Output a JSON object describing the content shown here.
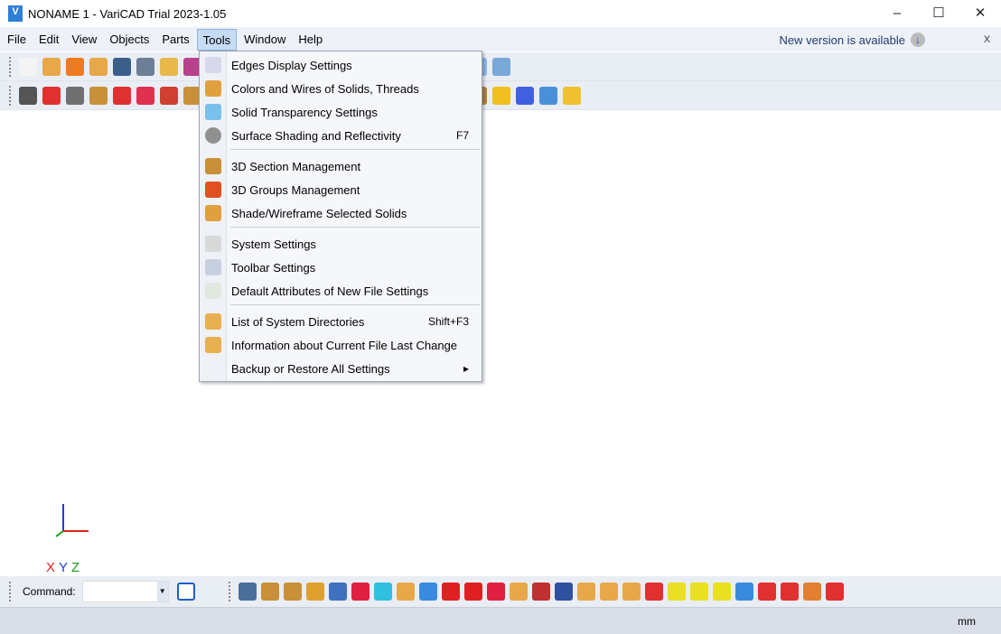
{
  "window": {
    "title": "NONAME 1 - VariCAD Trial 2023-1.05",
    "logo": "VariCAD",
    "minimize": "–",
    "maximize": "☐",
    "close": "✕"
  },
  "menubar": {
    "items": [
      "File",
      "Edit",
      "View",
      "Objects",
      "Parts",
      "Tools",
      "Window",
      "Help"
    ],
    "active": "Tools",
    "new_version": "New version is available",
    "download_icon": "↓",
    "close_label": "x"
  },
  "toolbar": {
    "row1": [
      "#f4f4f4",
      "#e8a84a",
      "#f07a20",
      "#e8a84a",
      "#3c5f8a",
      "#6c7f96",
      "#e8b84a",
      "#b8408c",
      "#7ab0e0",
      "#5a9ad6",
      "#6aa8e0",
      "#4a86c8",
      "#909090",
      "#808080",
      "#a0a0a0",
      "#c89038",
      "#d04040",
      "#7ab8e0",
      "#8ab8e8",
      "#7aa8d8"
    ],
    "row2": [
      "#555555",
      "#e03030",
      "#707070",
      "#c89038",
      "#e03030",
      "#e03050",
      "#d04030",
      "#c89038",
      "#c03030",
      "#a0a8b0",
      "#e04020",
      "#f07020",
      "#f07020",
      "#e04020",
      "#f07020",
      "#f07020",
      "#f07020",
      "#f0c020",
      "#b08040",
      "#f0c020",
      "#4060e0",
      "#4a90d8",
      "#f0c030"
    ]
  },
  "tools_menu": {
    "items": [
      {
        "label": "Edges Display Settings",
        "shortcut": "",
        "icon": "edges-display-icon",
        "color": "#d8d8ec"
      },
      {
        "label": "Colors and Wires of Solids, Threads",
        "shortcut": "",
        "icon": "colors-wires-icon",
        "color": "#e0a040"
      },
      {
        "label": "Solid Transparency Settings",
        "shortcut": "",
        "icon": "transparency-icon",
        "color": "#7ac0ec"
      },
      {
        "label": "Surface Shading and Reflectivity",
        "shortcut": "F7",
        "icon": "shading-sphere-icon",
        "color": "#909090"
      },
      {
        "label": "3D Section Management",
        "shortcut": "",
        "icon": "section-icon",
        "color": "#c89038"
      },
      {
        "label": "3D Groups Management",
        "shortcut": "",
        "icon": "groups-icon",
        "color": "#e05020"
      },
      {
        "label": "Shade/Wireframe Selected Solids",
        "shortcut": "",
        "icon": "shade-wireframe-icon",
        "color": "#e0a040"
      },
      {
        "label": "System Settings",
        "shortcut": "",
        "icon": "gear-icon",
        "color": "#d8d8d8"
      },
      {
        "label": "Toolbar Settings",
        "shortcut": "",
        "icon": "toolbar-settings-icon",
        "color": "#c8d0e0"
      },
      {
        "label": "Default Attributes of New File Settings",
        "shortcut": "",
        "icon": "new-file-settings-icon",
        "color": "#e0e8e0"
      },
      {
        "label": "List of System Directories",
        "shortcut": "Shift+F3",
        "icon": "folder-question-icon",
        "color": "#e8b050"
      },
      {
        "label": "Information about Current File Last Change",
        "shortcut": "",
        "icon": "file-info-icon",
        "color": "#e8b050"
      },
      {
        "label": "Backup or Restore All Settings",
        "shortcut": "▸",
        "icon": "backup-icon",
        "color": "transparent"
      }
    ]
  },
  "axes": {
    "x": "X",
    "y": "Y",
    "z": "Z"
  },
  "command": {
    "label": "Command:",
    "value": ""
  },
  "bottom_toolbar": [
    "#4a6e98",
    "#c89038",
    "#c89038",
    "#e0a030",
    "#4070c0",
    "#e02040",
    "#30c0e0",
    "#e8a84a",
    "#3a8ae0",
    "#e02020",
    "#e02020",
    "#e02040",
    "#e8a84a",
    "#c03030",
    "#3050a0",
    "#e8a84a",
    "#e8a84a",
    "#e8a84a",
    "#e03030",
    "#e8e020",
    "#e8e020",
    "#e8e020",
    "#3a8ae0",
    "#e03030",
    "#e03030",
    "#e08030",
    "#e03030"
  ],
  "status": {
    "units": "mm"
  }
}
